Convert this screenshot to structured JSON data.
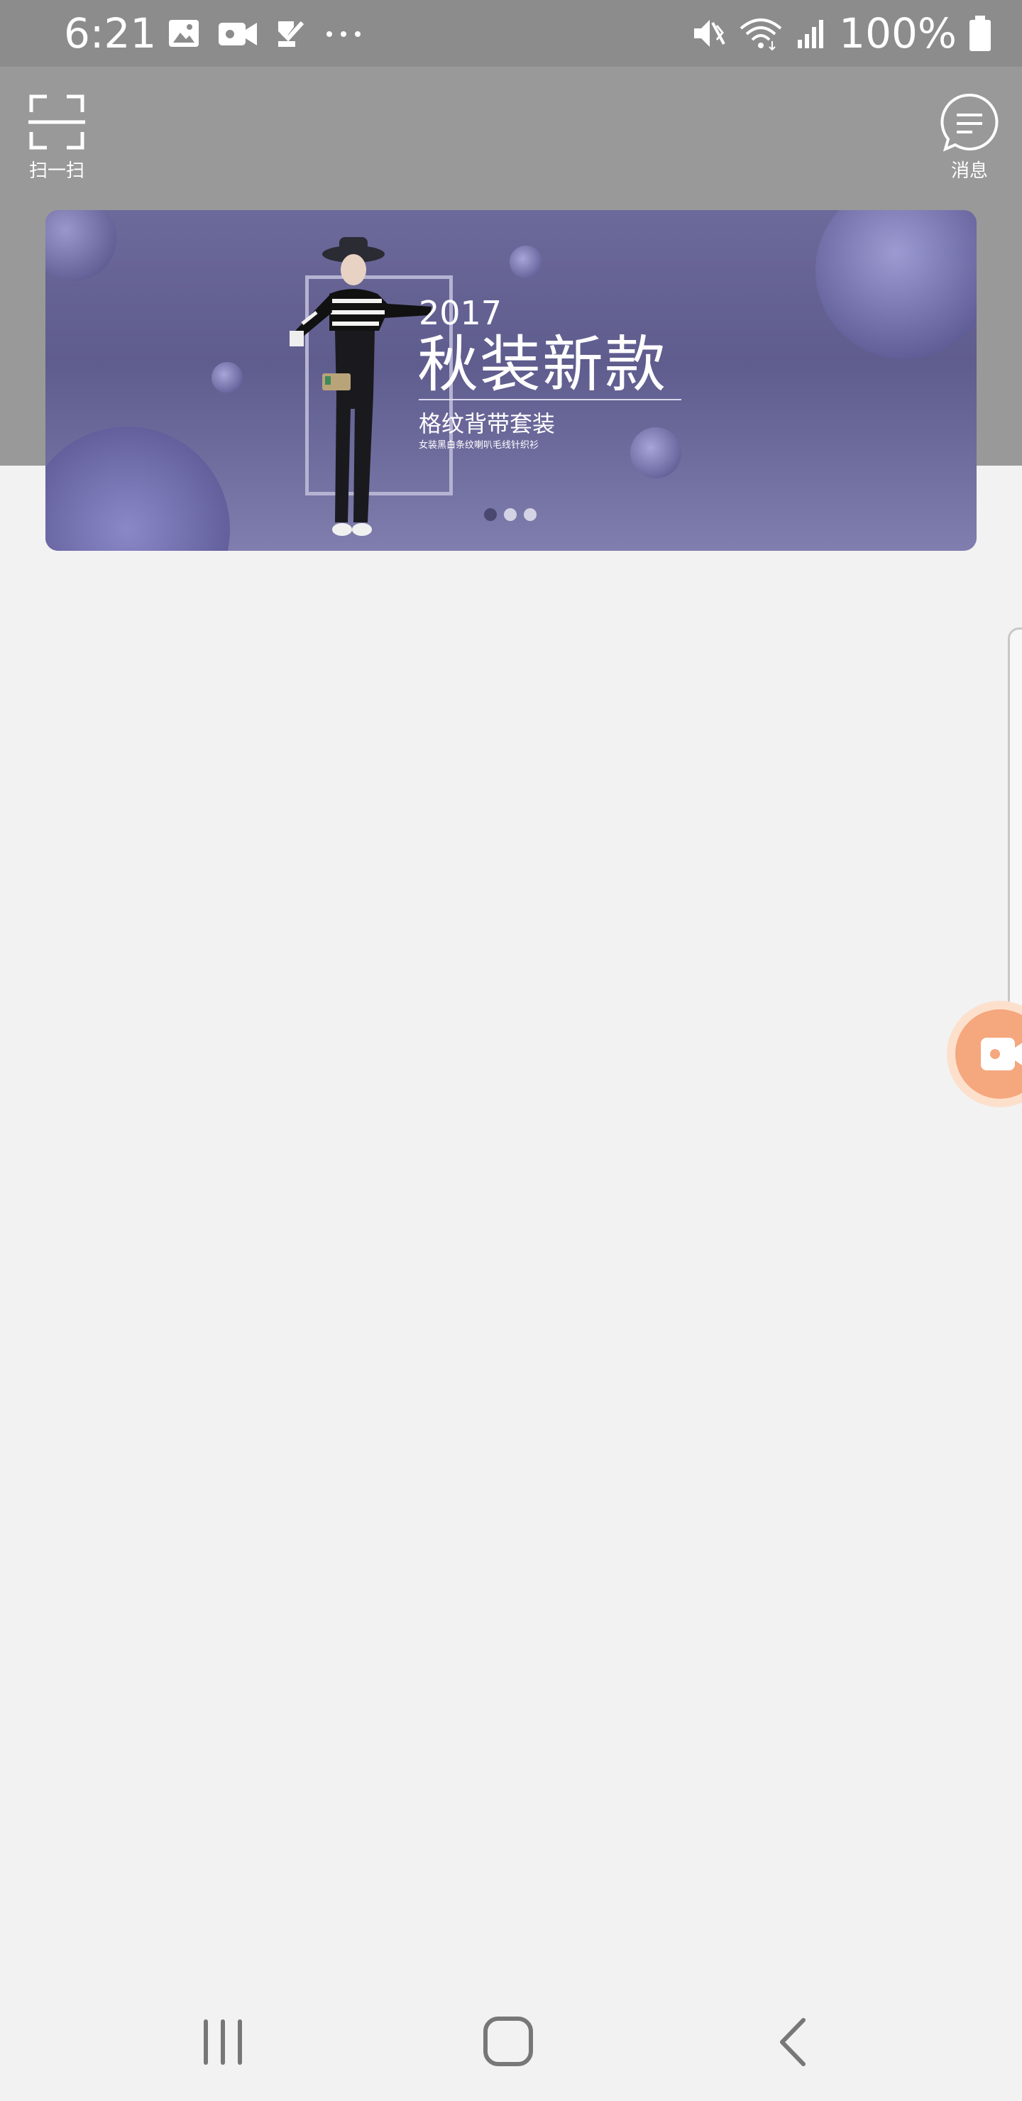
{
  "status_bar": {
    "time": "6:21",
    "battery_text": "100%",
    "left_icons": [
      "image-icon",
      "video-icon",
      "check-icon",
      "more-dots-icon"
    ],
    "right_icons": [
      "mute-icon",
      "wifi-icon",
      "signal-icon",
      "battery-icon"
    ]
  },
  "header": {
    "scan_label": "扫一扫",
    "message_label": "消息"
  },
  "banner": {
    "year": "2017",
    "title": "秋装新款",
    "subtitle": "格纹背带套装",
    "small_text": "女装黑白条纹喇叭毛线针织衫",
    "slide_count": 3,
    "active_slide": 1
  },
  "colors": {
    "status_bar": "#8c8c8c",
    "header_band": "#999999",
    "page_bg": "#f2f2f2",
    "banner_purple": "#6c6a9a",
    "record_button": "#f5a77e"
  },
  "navigation": {
    "buttons": [
      "recents-icon",
      "home-icon",
      "back-icon"
    ]
  }
}
